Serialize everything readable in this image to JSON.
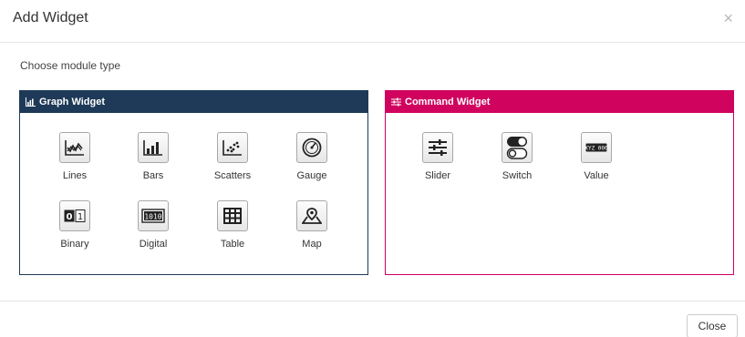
{
  "modal": {
    "title": "Add Widget",
    "close_symbol": "×",
    "subtitle": "Choose module type",
    "close_button_label": "Close"
  },
  "graph_panel": {
    "title": "Graph Widget",
    "icon": "bar-chart-icon",
    "color": "#1e3a58",
    "widgets": [
      {
        "label": "Lines",
        "icon": "lines-chart-icon"
      },
      {
        "label": "Bars",
        "icon": "bars-chart-icon"
      },
      {
        "label": "Scatters",
        "icon": "scatter-chart-icon"
      },
      {
        "label": "Gauge",
        "icon": "gauge-icon"
      },
      {
        "label": "Binary",
        "icon": "binary-icon"
      },
      {
        "label": "Digital",
        "icon": "digital-icon"
      },
      {
        "label": "Table",
        "icon": "table-icon"
      },
      {
        "label": "Map",
        "icon": "map-pin-icon"
      }
    ]
  },
  "command_panel": {
    "title": "Command Widget",
    "icon": "sliders-icon",
    "color": "#d0045f",
    "widgets": [
      {
        "label": "Slider",
        "icon": "slider-icon"
      },
      {
        "label": "Switch",
        "icon": "switch-icon"
      },
      {
        "label": "Value",
        "icon": "value-icon"
      }
    ]
  }
}
